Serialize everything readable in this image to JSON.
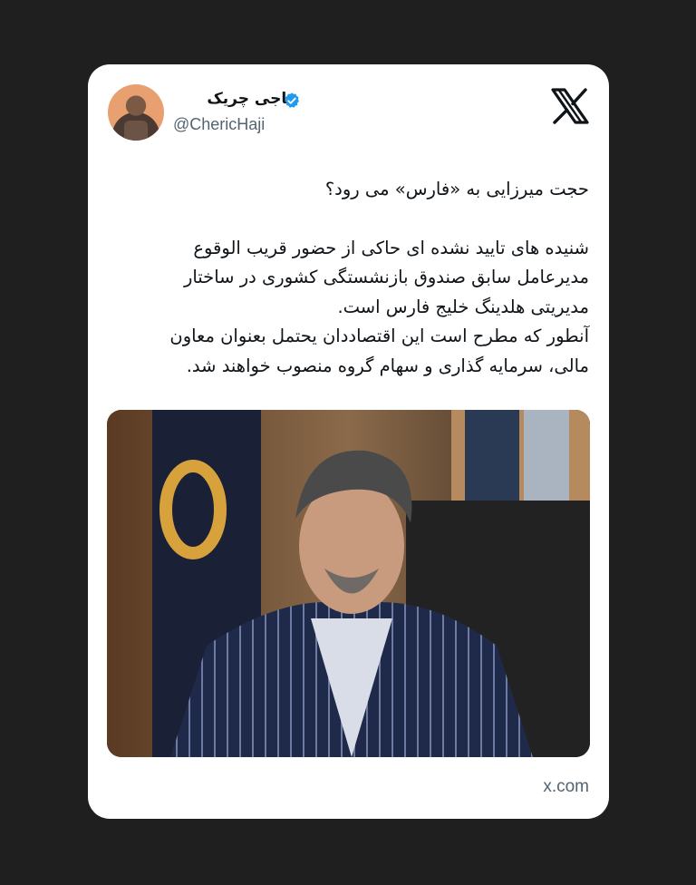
{
  "tweet": {
    "author": {
      "display_name": "حاجی چریک",
      "handle": "@ChericHaji",
      "verified": true,
      "verified_color": "#1d9bf0"
    },
    "platform_icon": "x-logo-icon",
    "title_line": "حجت میرزایی به «فارس» می رود؟",
    "body_lines": [
      "شنیده های تایید نشده ای حاکی از حضور قریب الوقوع",
      "مدیرعامل سابق صندوق بازنشستگی کشوری در ساختار",
      "مدیریتی هلدینگ خلیج فارس است.",
      "آنطور که مطرح است این اقتصاددان یحتمل بعنوان معاون",
      "مالی، سرمایه گذاری و سهام گروه منصوب خواهند شد."
    ],
    "media": {
      "type": "photo"
    },
    "source_link": "x.com"
  }
}
